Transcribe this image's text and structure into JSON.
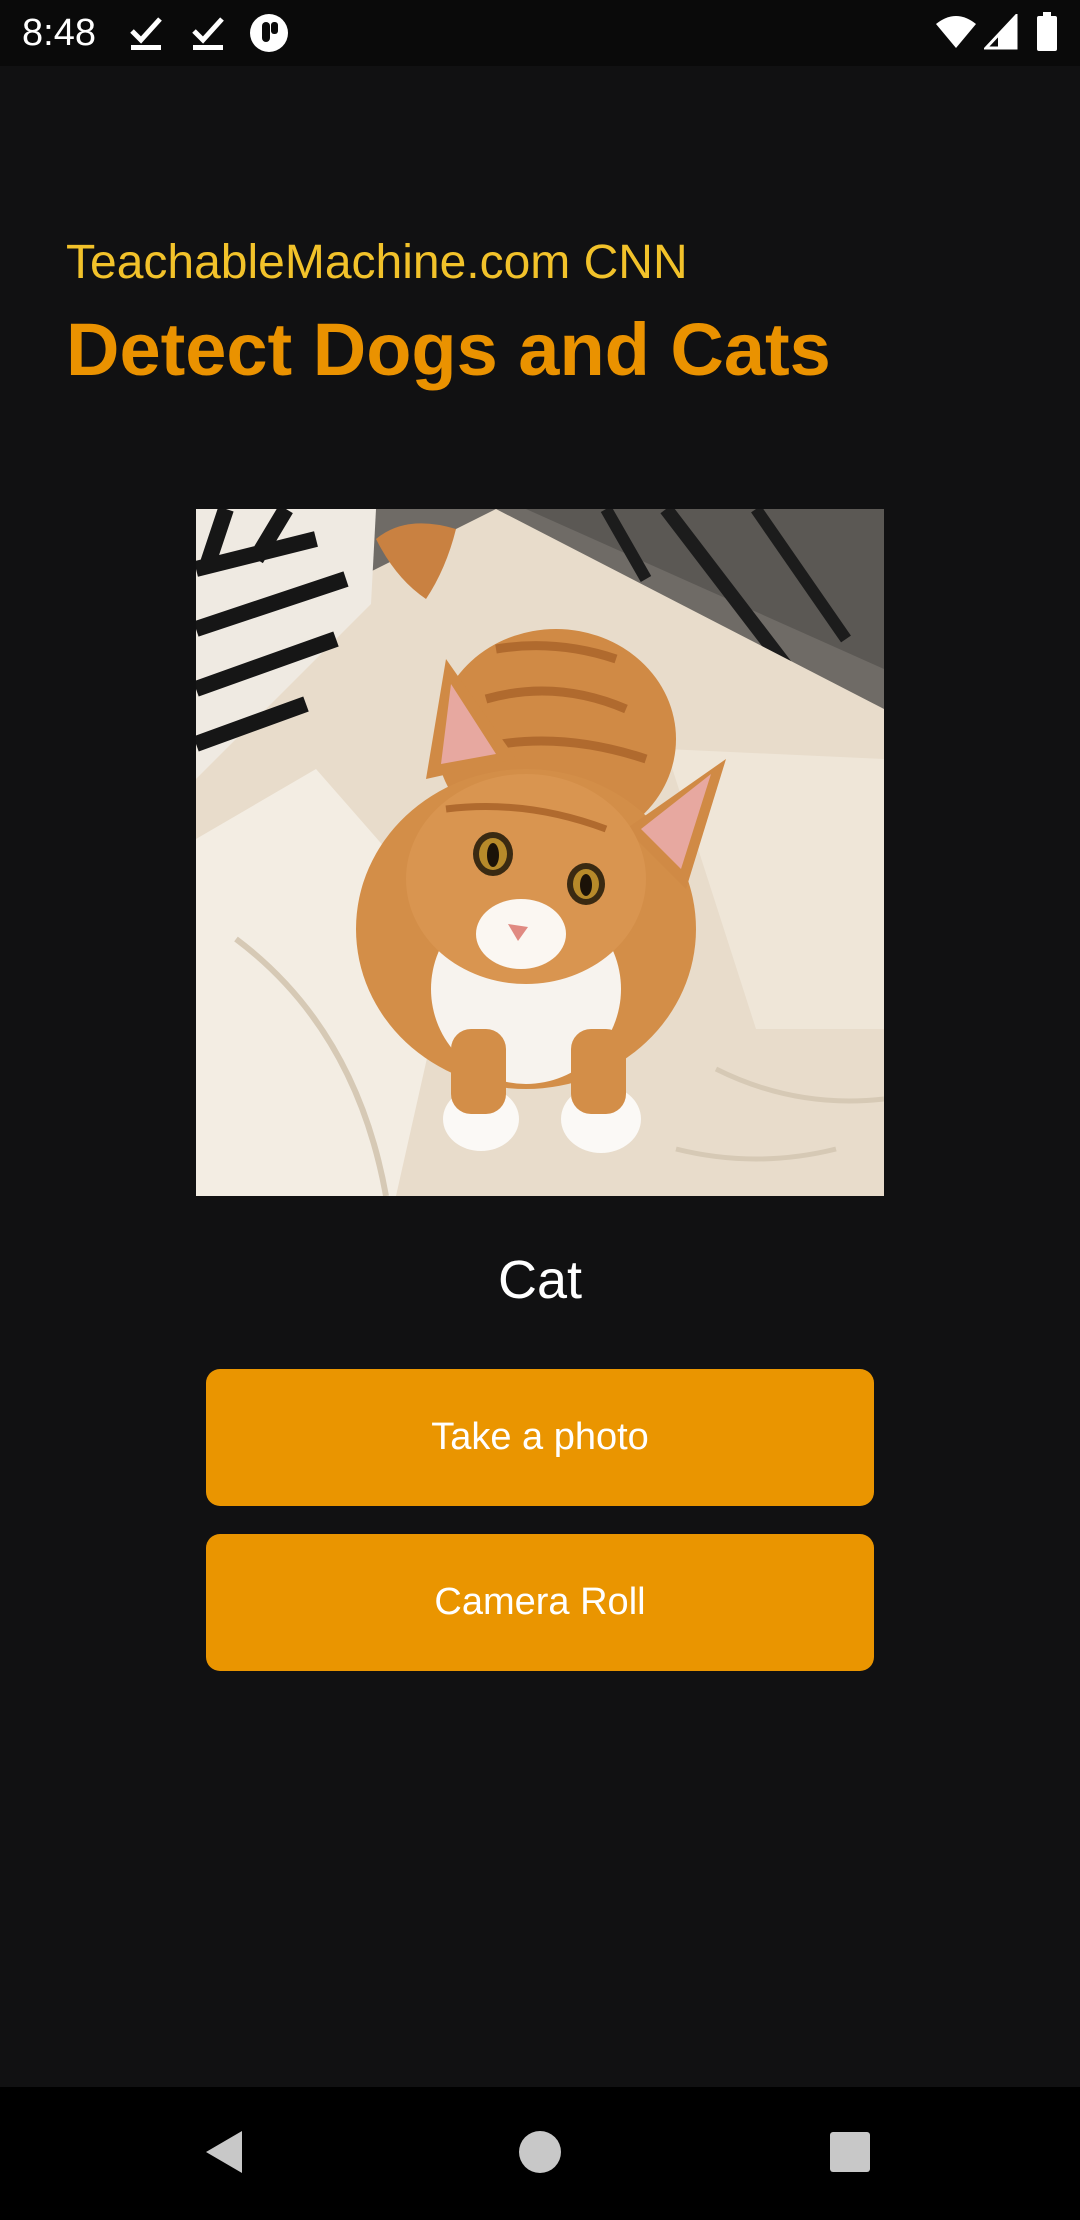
{
  "status_bar": {
    "time": "8:48",
    "icons": [
      "download-done-icon",
      "download-done-icon",
      "app-notification-icon",
      "wifi-icon",
      "signal-icon",
      "battery-icon"
    ]
  },
  "header": {
    "subtitle": "TeachableMachine.com CNN",
    "title": "Detect Dogs and Cats"
  },
  "photo": {
    "subject": "cat-photo"
  },
  "result": {
    "label": "Cat"
  },
  "buttons": {
    "take_photo": "Take a photo",
    "camera_roll": "Camera Roll"
  },
  "nav_bar": {
    "icons": [
      "back-icon",
      "home-icon",
      "recents-icon"
    ]
  },
  "colors": {
    "background": "#111112",
    "subtitle": "#f2c22a",
    "title": "#ea9200",
    "button": "#ea9500"
  }
}
